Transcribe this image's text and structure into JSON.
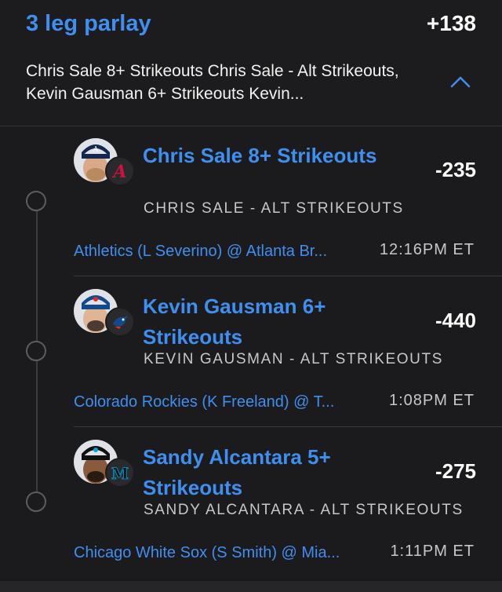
{
  "parlay": {
    "title": "3 leg parlay",
    "odds": "+138",
    "summary": "Chris Sale 8+ Strikeouts Chris Sale - Alt Strikeouts, Kevin Gausman 6+ Strikeouts Kevin..."
  },
  "legs": [
    {
      "title": "Chris Sale 8+ Strikeouts",
      "odds": "-235",
      "market": "CHRIS SALE - ALT STRIKEOUTS",
      "matchup": "Athletics (L Severino) @ Atlanta Br...",
      "time": "12:16PM ET",
      "team_icon": "braves-logo-icon",
      "team_color": "#ce1141"
    },
    {
      "title": "Kevin Gausman 6+ Strikeouts",
      "odds": "-440",
      "market": "KEVIN GAUSMAN - ALT STRIKEOUTS",
      "matchup": "Colorado Rockies (K Freeland) @ T...",
      "time": "1:08PM ET",
      "team_icon": "blue-jays-logo-icon",
      "team_color": "#134a8e"
    },
    {
      "title": "Sandy Alcantara 5+ Strikeouts",
      "odds": "-275",
      "market": "SANDY ALCANTARA - ALT STRIKEOUTS",
      "matchup": "Chicago White Sox (S Smith) @ Mia...",
      "time": "1:11PM ET",
      "team_icon": "marlins-logo-icon",
      "team_color": "#00a3e0"
    }
  ],
  "colors": {
    "accent": "#3f8ff0",
    "background": "#1b1b1d",
    "muted_text": "#c7c7cc"
  }
}
